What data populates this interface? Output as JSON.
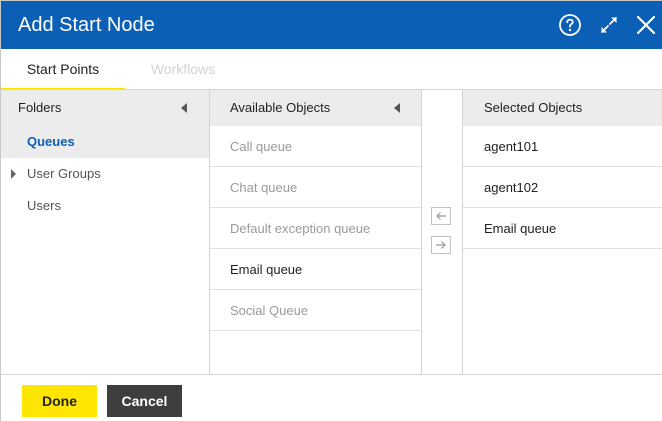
{
  "dialog": {
    "title": "Add Start Node",
    "icons": {
      "help": "help-circle-icon",
      "maximize": "expand-arrows-icon",
      "close": "close-icon"
    },
    "colors": {
      "titlebar": "#0b5fb4",
      "accent": "#ffe600",
      "cancel": "#3e3e3e"
    }
  },
  "tabs": [
    {
      "label": "Start Points",
      "active": true
    },
    {
      "label": "Workflows",
      "active": false
    }
  ],
  "folders": {
    "header": "Folders",
    "items": [
      {
        "label": "Queues",
        "active": true
      },
      {
        "label": "User Groups",
        "expandable": true
      },
      {
        "label": "Users"
      }
    ]
  },
  "available": {
    "header": "Available Objects",
    "items": [
      {
        "label": "Call queue",
        "enabled": false
      },
      {
        "label": "Chat queue",
        "enabled": false
      },
      {
        "label": "Default exception queue",
        "enabled": false
      },
      {
        "label": "Email queue",
        "enabled": true
      },
      {
        "label": "Social Queue",
        "enabled": false
      }
    ]
  },
  "transfer": {
    "remove_icon": "arrow-left-icon",
    "add_icon": "arrow-right-icon"
  },
  "selected": {
    "header": "Selected Objects",
    "items": [
      {
        "label": "agent101"
      },
      {
        "label": "agent102"
      },
      {
        "label": "Email queue"
      }
    ]
  },
  "footer": {
    "done_label": "Done",
    "cancel_label": "Cancel"
  }
}
